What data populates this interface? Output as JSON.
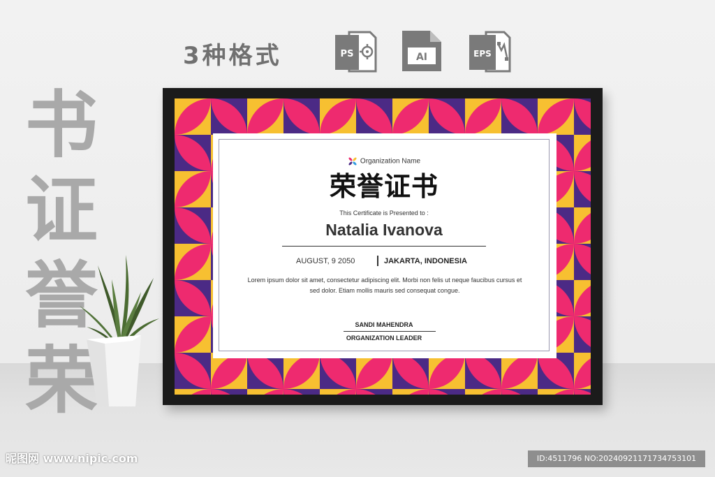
{
  "heading": {
    "formats_title": "3种格式",
    "icons": [
      {
        "name": "ps-file-icon",
        "label": "PS"
      },
      {
        "name": "ai-file-icon",
        "label": "AI"
      },
      {
        "name": "eps-file-icon",
        "label": "EPS"
      }
    ]
  },
  "side_title": [
    "书",
    "证",
    "誉",
    "荣"
  ],
  "certificate": {
    "organization": "Organization Name",
    "title": "荣誉证书",
    "presented_to": "This Certificate is Presented to :",
    "recipient": "Natalia Ivanova",
    "date": "AUGUST, 9 2050",
    "location": "JAKARTA, INDONESIA",
    "body": "Lorem ipsum dolor sit amet, consectetur adipiscing elit. Morbi non felis ut neque faucibus cursus et sed dolor. Etiam mollis mauris sed consequat congue.",
    "signer_name": "SANDI MAHENDRA",
    "signer_role": "ORGANIZATION LEADER"
  },
  "colors": {
    "pink": "#ee2a6f",
    "purple": "#4b2a85",
    "yellow": "#f7c031",
    "frame": "#1b1b1b"
  },
  "watermark": {
    "site": "昵图网 www.nipic.com",
    "id": "ID:4511796 NO:20240921171734753101"
  }
}
